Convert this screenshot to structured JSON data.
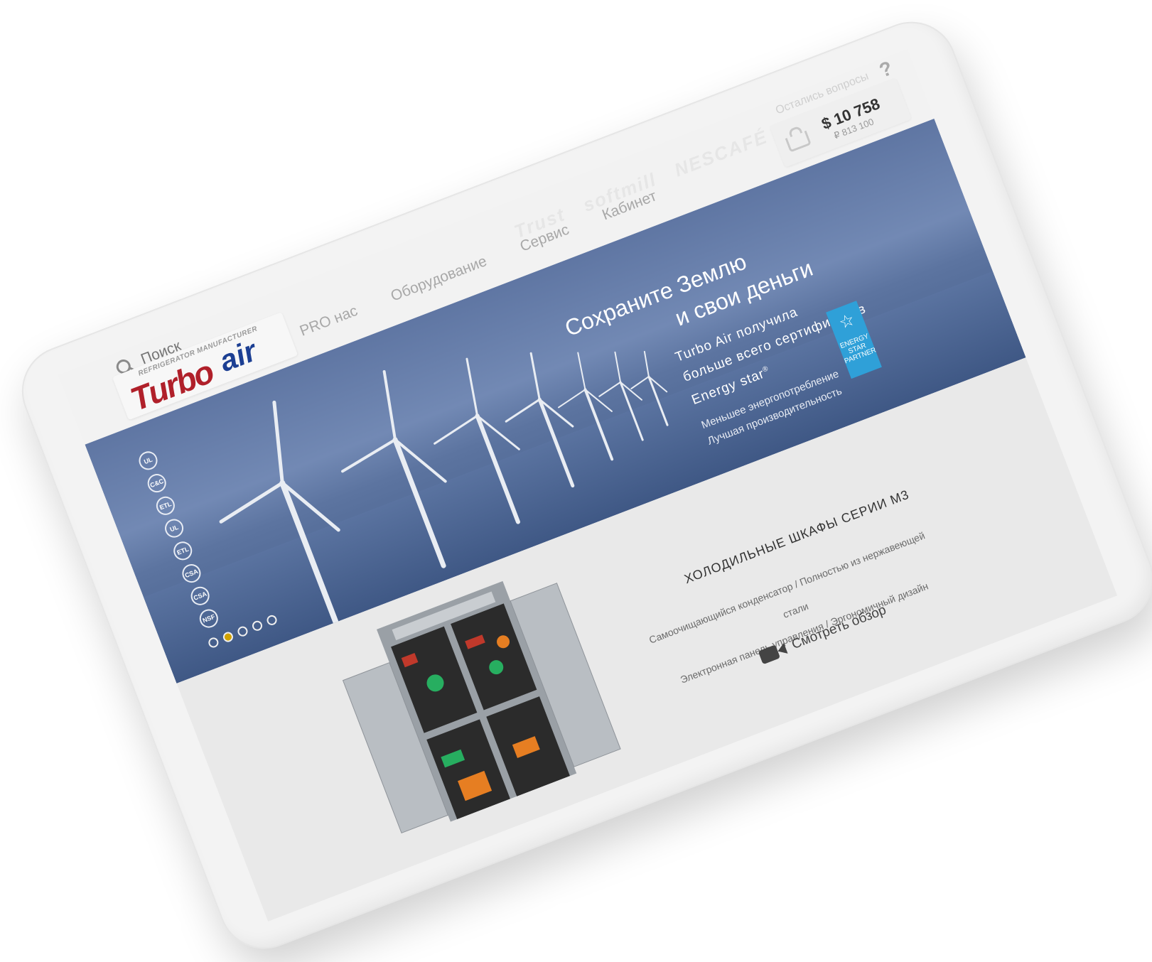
{
  "search": {
    "placeholder": "Поиск"
  },
  "logo": {
    "brand_part1": "Turbo",
    "brand_part2": "air",
    "tagline": "REFRIGERATOR MANUFACTURER"
  },
  "nav": [
    "PRO нас",
    "Оборудование",
    "Сервис",
    "Кабинет"
  ],
  "partners": [
    "Trust",
    "softmill",
    "NESCAFÉ"
  ],
  "help": {
    "text": "Остались вопросы",
    "icon": "question-icon"
  },
  "cart": {
    "icon": "basket-icon",
    "price_usd": "$ 10 758",
    "price_rub": "₽ 813 100"
  },
  "hero": {
    "title_line1": "Сохраните Землю",
    "title_line2": "и свои деньги",
    "sub_line1": "Turbo Air получила",
    "sub_line2": "больше всего сертификатов",
    "sub_line3": "Energy star",
    "sub_reg": "®",
    "small_line1": "Меньшее энергопотребление",
    "small_line2": "Лучшая производительность",
    "badge_text": "ENERGY STAR PARTNER",
    "certs": [
      "UL",
      "C&C",
      "ETL",
      "UL",
      "ETL",
      "CSA",
      "CSA",
      "NSF"
    ],
    "slides": 5,
    "active_slide": 2,
    "accent_color": "#d1a200"
  },
  "product": {
    "title": "ХОЛОДИЛЬНЫЕ ШКАФЫ СЕРИИ M3",
    "features_line1": "Самоочищающийся конденсатор / Полностью из нержавеющей стали",
    "features_line2": "Электронная панель управления / Эргономичный дизайн",
    "review_label": "Смотреть обзор",
    "review_icon": "video-camera-icon"
  }
}
